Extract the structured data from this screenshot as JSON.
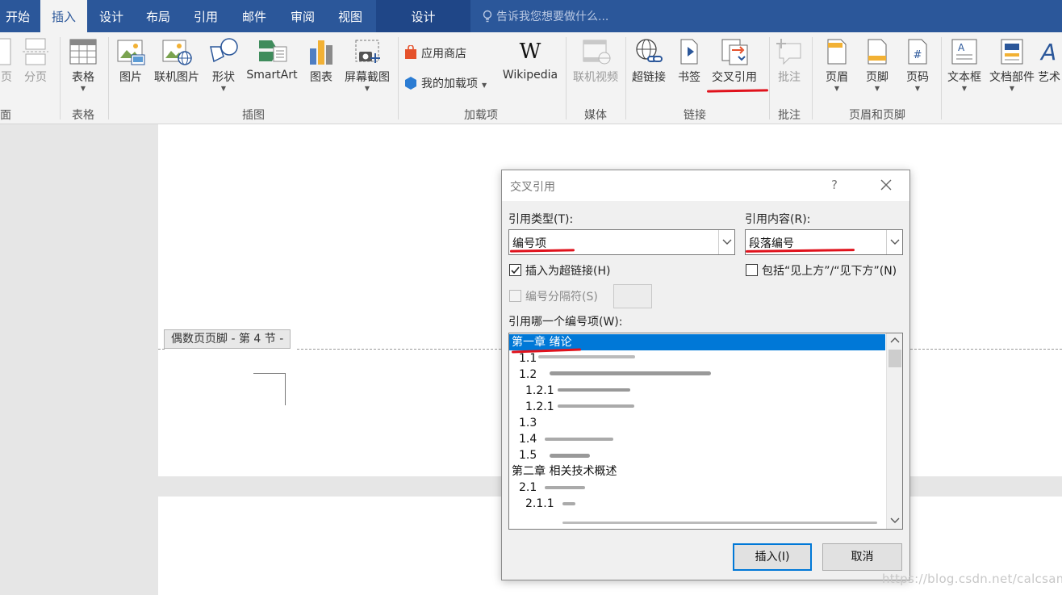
{
  "tabs": [
    {
      "label": "开始",
      "active": false
    },
    {
      "label": "插入",
      "active": true
    },
    {
      "label": "设计",
      "active": false
    },
    {
      "label": "布局",
      "active": false
    },
    {
      "label": "引用",
      "active": false
    },
    {
      "label": "邮件",
      "active": false
    },
    {
      "label": "审阅",
      "active": false
    },
    {
      "label": "视图",
      "active": false
    },
    {
      "label": "设计",
      "active": false
    }
  ],
  "tell_me": "告诉我您想要做什么...",
  "ribbon": {
    "page_cut": "页",
    "page_break": "分页",
    "table": "表格",
    "picture": "图片",
    "online_picture": "联机图片",
    "shapes": "形状",
    "smartart": "SmartArt",
    "chart": "图表",
    "screenshot": "屏幕截图",
    "app_store": "应用商店",
    "my_addins": "我的加载项",
    "wikipedia": "Wikipedia",
    "online_video": "联机视频",
    "hyperlink": "超链接",
    "bookmark": "书签",
    "cross_reference": "交叉引用",
    "comment": "批注",
    "header": "页眉",
    "footer": "页脚",
    "page_number": "页码",
    "textbox": "文本框",
    "quick_parts": "文档部件",
    "wordart": "艺术",
    "groups": {
      "pages": "面",
      "tables": "表格",
      "illustrations": "插图",
      "addins": "加载项",
      "media": "媒体",
      "links": "链接",
      "comments": "批注",
      "header_footer": "页眉和页脚"
    }
  },
  "document": {
    "footer_tag": "偶数页页脚 - 第 4 节 -"
  },
  "dialog": {
    "title": "交叉引用",
    "help": "?",
    "ref_type_label": "引用类型(T):",
    "ref_type_value": "编号项",
    "ref_content_label": "引用内容(R):",
    "ref_content_value": "段落编号",
    "insert_hyperlink_label": "插入为超链接(H)",
    "insert_hyperlink_checked": true,
    "include_above_below_label": "包括“见上方”/“见下方”(N)",
    "include_above_below_checked": false,
    "separator_label": "编号分隔符(S)",
    "which_item_label": "引用哪一个编号项(W):",
    "items": [
      {
        "text": "第一章 绪论",
        "selected": true
      },
      {
        "text": "1.1",
        "selected": false
      },
      {
        "text": "1.2",
        "selected": false
      },
      {
        "text": "1.2.1",
        "selected": false
      },
      {
        "text": "1.2.1",
        "selected": false
      },
      {
        "text": "1.3",
        "selected": false
      },
      {
        "text": "1.4",
        "selected": false
      },
      {
        "text": "1.5",
        "selected": false
      },
      {
        "text": "第二章 相关技术概述",
        "selected": false
      },
      {
        "text": "2.1",
        "selected": false
      },
      {
        "text": "2.1.1",
        "selected": false
      }
    ],
    "insert_button": "插入(I)",
    "cancel_button": "取消"
  },
  "watermark": "https://blog.csdn.net/calcsama",
  "colors": {
    "title_bar": "#2b579a",
    "selection": "#0078d7",
    "annotation_red": "#e0121c"
  }
}
